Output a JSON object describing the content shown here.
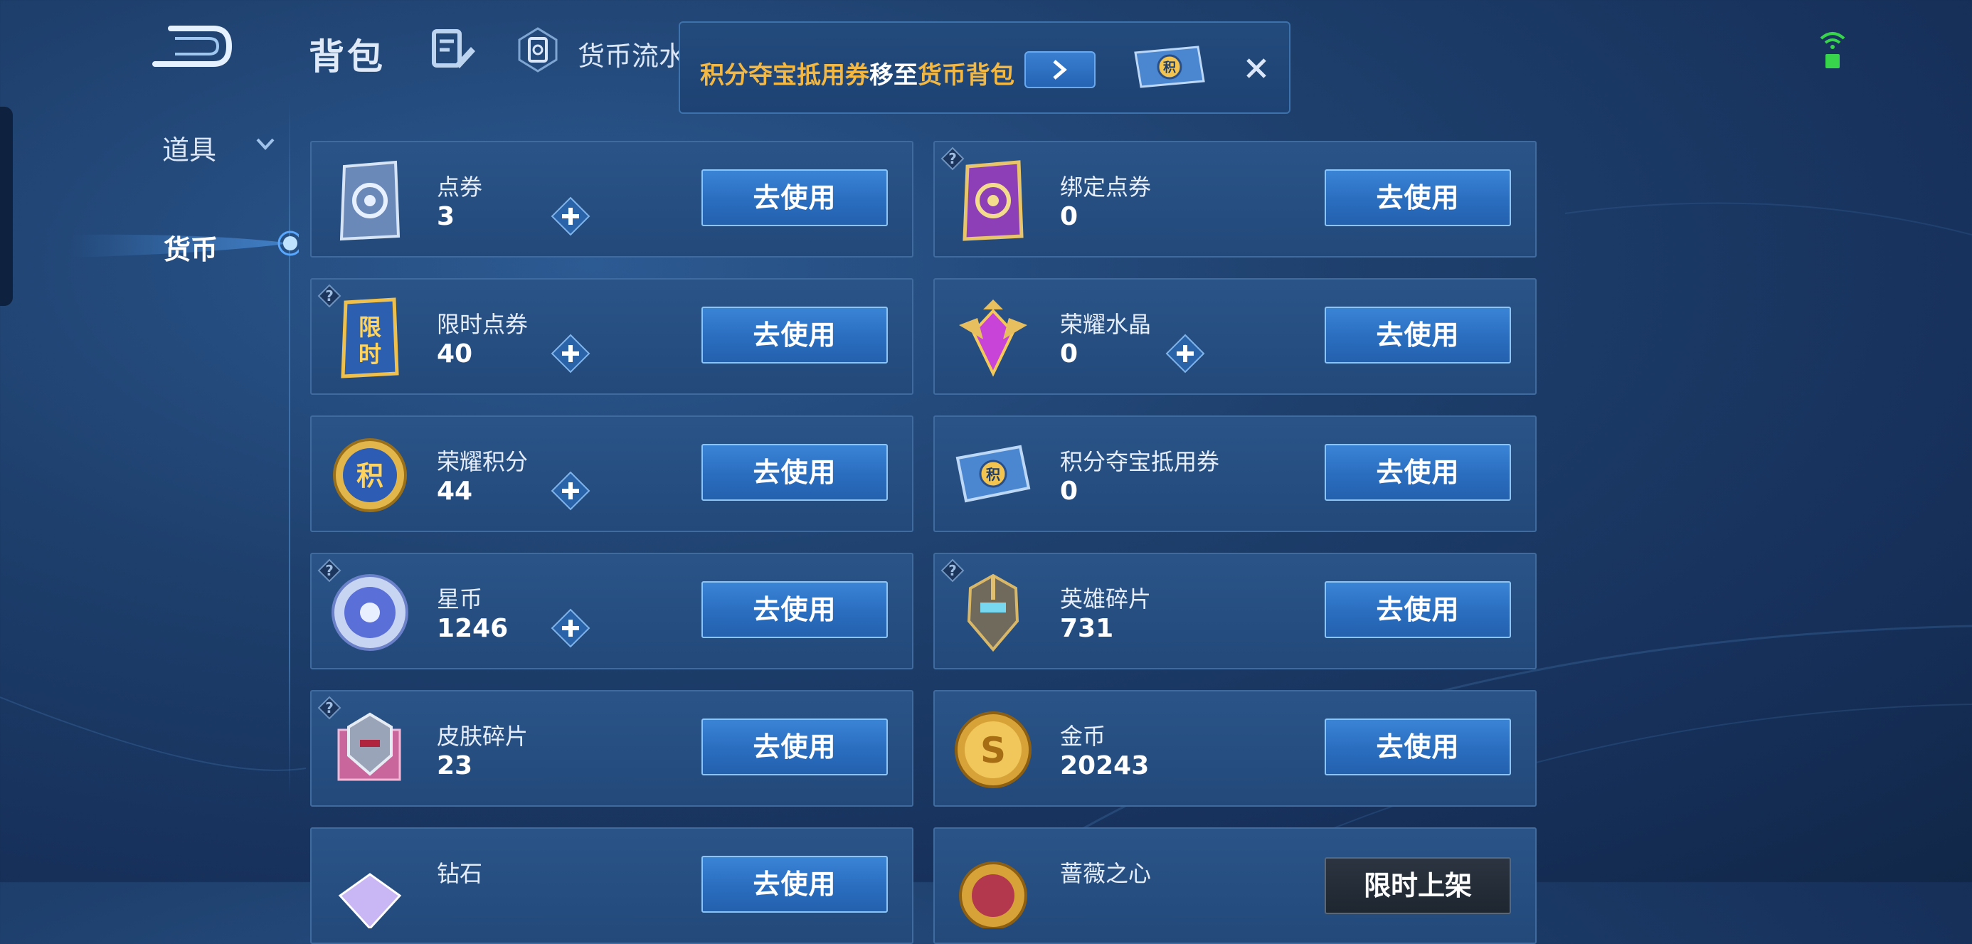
{
  "header": {
    "title": "背包",
    "ledger_label": "货币流水"
  },
  "sidebar": {
    "items": [
      {
        "label": "道具"
      },
      {
        "label": "货币"
      }
    ]
  },
  "toast": {
    "part1": "积分夺宝抵用券",
    "part2": "移至",
    "part3": "货币背包"
  },
  "currencies": [
    {
      "name": "点券",
      "count": "3",
      "button": "去使用"
    },
    {
      "name": "绑定点券",
      "count": "0",
      "button": "去使用"
    },
    {
      "name": "限时点券",
      "count": "40",
      "button": "去使用"
    },
    {
      "name": "荣耀水晶",
      "count": "0",
      "button": "去使用"
    },
    {
      "name": "荣耀积分",
      "count": "44",
      "button": "去使用"
    },
    {
      "name": "积分夺宝抵用券",
      "count": "0",
      "button": "去使用"
    },
    {
      "name": "星币",
      "count": "1246",
      "button": "去使用"
    },
    {
      "name": "英雄碎片",
      "count": "731",
      "button": "去使用"
    },
    {
      "name": "皮肤碎片",
      "count": "23",
      "button": "去使用"
    },
    {
      "name": "金币",
      "count": "20243",
      "button": "去使用"
    },
    {
      "name": "钻石",
      "count": "",
      "button": "去使用"
    },
    {
      "name": "蔷薇之心",
      "count": "",
      "button": "限时上架"
    }
  ],
  "colors": {
    "accent_gold": "#f3b844",
    "button_blue": "#2a6dbf",
    "card_bg": "#23497a",
    "background": "#1e3f6c"
  }
}
